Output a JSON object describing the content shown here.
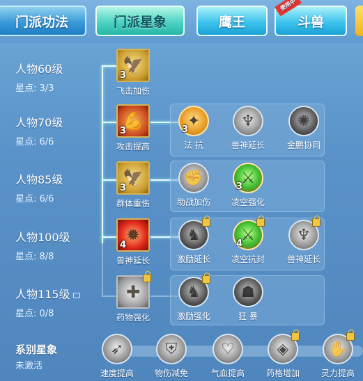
{
  "tabs": {
    "main": [
      "门派功法",
      "门派星象"
    ],
    "sub": [
      "鹰王",
      "斗兽"
    ],
    "badge": "使用中"
  },
  "levels": [
    {
      "name": "人物60级",
      "stars": "星点: 3/3"
    },
    {
      "name": "人物70级",
      "stars": "星点: 6/6"
    },
    {
      "name": "人物85级",
      "stars": "星点: 6/6"
    },
    {
      "name": "人物100级",
      "stars": "星点: 8/8"
    },
    {
      "name": "人物115级",
      "stars": "星点: 0/8"
    }
  ],
  "rows": [
    {
      "skills": [
        {
          "label": "飞击加伤",
          "count": "3",
          "icon": "eagle-icon"
        }
      ]
    },
    {
      "skills": [
        {
          "label": "攻击提高",
          "count": "3",
          "icon": "flexed-arm-icon"
        },
        {
          "label": "法 抗",
          "count": "3",
          "icon": "golden-figure-icon"
        },
        {
          "label": "兽神延长",
          "count": "",
          "icon": "beast-god-icon"
        },
        {
          "label": "金鹏协同",
          "count": "",
          "icon": "golden-roc-icon"
        }
      ]
    },
    {
      "skills": [
        {
          "label": "群体重伤",
          "count": "3",
          "icon": "eagle-icon"
        },
        {
          "label": "助战加伤",
          "count": "",
          "icon": "fist-icon"
        },
        {
          "label": "凌空强化",
          "count": "3",
          "icon": "flying-warrior-icon"
        }
      ]
    },
    {
      "skills": [
        {
          "label": "兽神延长",
          "count": "4",
          "icon": "flaming-figure-icon"
        },
        {
          "label": "激励延长",
          "count": "",
          "icon": "roaring-beast-icon"
        },
        {
          "label": "凌空抗封",
          "count": "4",
          "icon": "flying-warrior-icon"
        },
        {
          "label": "兽神延长",
          "count": "",
          "icon": "beast-god-icon"
        }
      ]
    },
    {
      "skills": [
        {
          "label": "药物强化",
          "count": "",
          "icon": "healing-figure-icon"
        },
        {
          "label": "激励强化",
          "count": "",
          "icon": "roaring-beast-icon"
        },
        {
          "label": "狂 暴",
          "count": "",
          "icon": "demon-mask-icon"
        }
      ]
    }
  ],
  "system": {
    "title": "系别星象",
    "status": "未激活",
    "skills": [
      {
        "label": "速度提高",
        "icon": "speed-icon"
      },
      {
        "label": "物伤减免",
        "icon": "shield-figure-icon"
      },
      {
        "label": "气血提高",
        "icon": "heart-icon"
      },
      {
        "label": "药格增加",
        "icon": "pill-icon"
      },
      {
        "label": "灵力提高",
        "icon": "spirit-hand-icon"
      }
    ]
  },
  "colors": {
    "active_tab": "#4ed2c3",
    "tab": "#3a9ad8",
    "line": "#e9faff",
    "badge": "#e3372f"
  }
}
